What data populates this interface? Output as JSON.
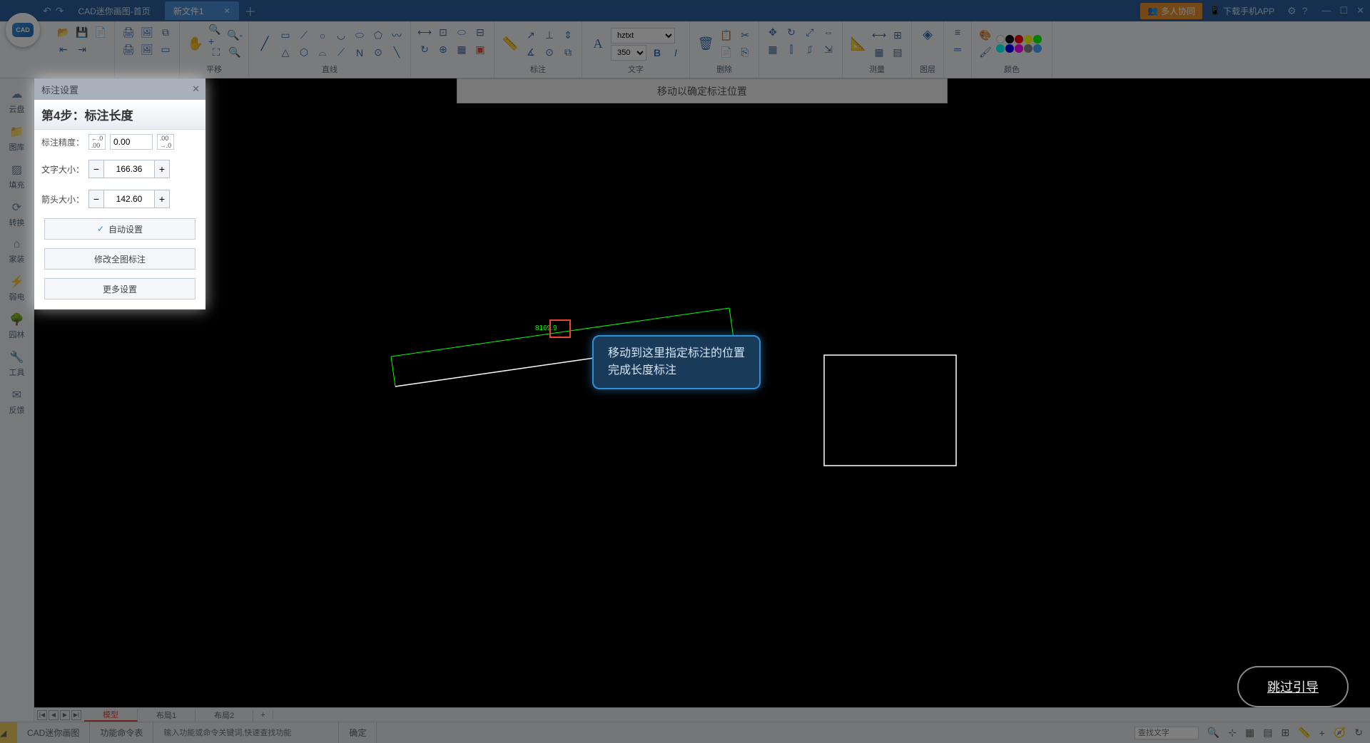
{
  "titlebar": {
    "tab_home": "CAD迷你画图-首页",
    "tab_file": "新文件1",
    "collab": "多人协同",
    "app_download": "下载手机APP"
  },
  "ribbon": {
    "pan": "平移",
    "line": "直线",
    "annotate": "标注",
    "text": "文字",
    "font_name": "hztxt",
    "font_size": "350",
    "delete": "删除",
    "measure": "测量",
    "layer": "图层",
    "color": "颜色"
  },
  "leftbar": {
    "cloud": "云盘",
    "library": "图库",
    "fill": "填充",
    "convert": "转换",
    "home_decor": "家装",
    "electric": "弱电",
    "garden": "园林",
    "tools": "工具",
    "feedback": "反馈"
  },
  "top_hint": "移动以确定标注位置",
  "panel": {
    "header": "标注设置",
    "step_title": "第4步：标注长度",
    "precision_label": "标注精度：",
    "precision_val": "0.00",
    "text_size_label": "文字大小：",
    "text_size_val": "166.36",
    "arrow_size_label": "箭头大小：",
    "arrow_size_val": "142.60",
    "auto_btn": "自动设置",
    "modify_btn": "修改全图标注",
    "more_btn": "更多设置"
  },
  "tooltip": {
    "line1": "移动到这里指定标注的位置",
    "line2": "完成长度标注"
  },
  "dim_value": "8169.9",
  "skip": "跳过引导",
  "bottom_tabs": {
    "model": "模型",
    "layout1": "布局1",
    "layout2": "布局2"
  },
  "statusbar": {
    "app_name": "CAD迷你画图",
    "cmd_table": "功能命令表",
    "cmd_placeholder": "输入功能或命令关键词,快速查找功能",
    "confirm": "确定",
    "search_placeholder": "查找文字"
  },
  "colors": {
    "primary": "#2c5f9e",
    "accent": "#e8932e",
    "tooltip_border": "#2d8fd8"
  }
}
